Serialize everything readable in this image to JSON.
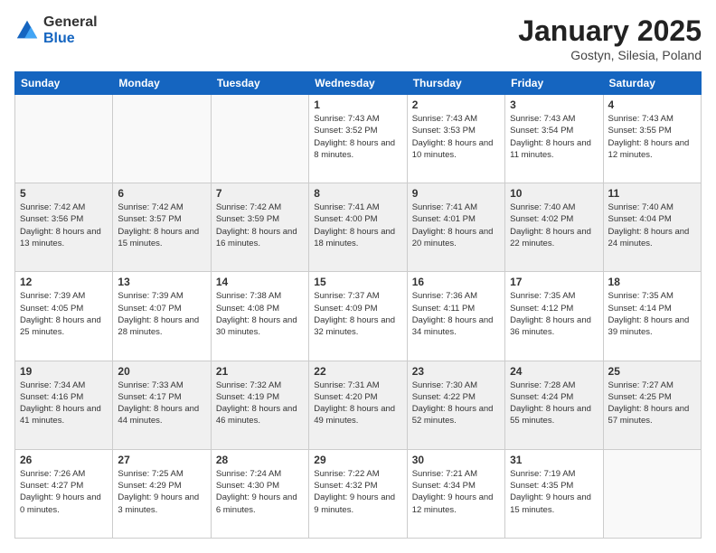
{
  "logo": {
    "general": "General",
    "blue": "Blue"
  },
  "header": {
    "month": "January 2025",
    "location": "Gostyn, Silesia, Poland"
  },
  "weekdays": [
    "Sunday",
    "Monday",
    "Tuesday",
    "Wednesday",
    "Thursday",
    "Friday",
    "Saturday"
  ],
  "weeks": [
    [
      {
        "day": "",
        "info": ""
      },
      {
        "day": "",
        "info": ""
      },
      {
        "day": "",
        "info": ""
      },
      {
        "day": "1",
        "info": "Sunrise: 7:43 AM\nSunset: 3:52 PM\nDaylight: 8 hours\nand 8 minutes."
      },
      {
        "day": "2",
        "info": "Sunrise: 7:43 AM\nSunset: 3:53 PM\nDaylight: 8 hours\nand 10 minutes."
      },
      {
        "day": "3",
        "info": "Sunrise: 7:43 AM\nSunset: 3:54 PM\nDaylight: 8 hours\nand 11 minutes."
      },
      {
        "day": "4",
        "info": "Sunrise: 7:43 AM\nSunset: 3:55 PM\nDaylight: 8 hours\nand 12 minutes."
      }
    ],
    [
      {
        "day": "5",
        "info": "Sunrise: 7:42 AM\nSunset: 3:56 PM\nDaylight: 8 hours\nand 13 minutes."
      },
      {
        "day": "6",
        "info": "Sunrise: 7:42 AM\nSunset: 3:57 PM\nDaylight: 8 hours\nand 15 minutes."
      },
      {
        "day": "7",
        "info": "Sunrise: 7:42 AM\nSunset: 3:59 PM\nDaylight: 8 hours\nand 16 minutes."
      },
      {
        "day": "8",
        "info": "Sunrise: 7:41 AM\nSunset: 4:00 PM\nDaylight: 8 hours\nand 18 minutes."
      },
      {
        "day": "9",
        "info": "Sunrise: 7:41 AM\nSunset: 4:01 PM\nDaylight: 8 hours\nand 20 minutes."
      },
      {
        "day": "10",
        "info": "Sunrise: 7:40 AM\nSunset: 4:02 PM\nDaylight: 8 hours\nand 22 minutes."
      },
      {
        "day": "11",
        "info": "Sunrise: 7:40 AM\nSunset: 4:04 PM\nDaylight: 8 hours\nand 24 minutes."
      }
    ],
    [
      {
        "day": "12",
        "info": "Sunrise: 7:39 AM\nSunset: 4:05 PM\nDaylight: 8 hours\nand 25 minutes."
      },
      {
        "day": "13",
        "info": "Sunrise: 7:39 AM\nSunset: 4:07 PM\nDaylight: 8 hours\nand 28 minutes."
      },
      {
        "day": "14",
        "info": "Sunrise: 7:38 AM\nSunset: 4:08 PM\nDaylight: 8 hours\nand 30 minutes."
      },
      {
        "day": "15",
        "info": "Sunrise: 7:37 AM\nSunset: 4:09 PM\nDaylight: 8 hours\nand 32 minutes."
      },
      {
        "day": "16",
        "info": "Sunrise: 7:36 AM\nSunset: 4:11 PM\nDaylight: 8 hours\nand 34 minutes."
      },
      {
        "day": "17",
        "info": "Sunrise: 7:35 AM\nSunset: 4:12 PM\nDaylight: 8 hours\nand 36 minutes."
      },
      {
        "day": "18",
        "info": "Sunrise: 7:35 AM\nSunset: 4:14 PM\nDaylight: 8 hours\nand 39 minutes."
      }
    ],
    [
      {
        "day": "19",
        "info": "Sunrise: 7:34 AM\nSunset: 4:16 PM\nDaylight: 8 hours\nand 41 minutes."
      },
      {
        "day": "20",
        "info": "Sunrise: 7:33 AM\nSunset: 4:17 PM\nDaylight: 8 hours\nand 44 minutes."
      },
      {
        "day": "21",
        "info": "Sunrise: 7:32 AM\nSunset: 4:19 PM\nDaylight: 8 hours\nand 46 minutes."
      },
      {
        "day": "22",
        "info": "Sunrise: 7:31 AM\nSunset: 4:20 PM\nDaylight: 8 hours\nand 49 minutes."
      },
      {
        "day": "23",
        "info": "Sunrise: 7:30 AM\nSunset: 4:22 PM\nDaylight: 8 hours\nand 52 minutes."
      },
      {
        "day": "24",
        "info": "Sunrise: 7:28 AM\nSunset: 4:24 PM\nDaylight: 8 hours\nand 55 minutes."
      },
      {
        "day": "25",
        "info": "Sunrise: 7:27 AM\nSunset: 4:25 PM\nDaylight: 8 hours\nand 57 minutes."
      }
    ],
    [
      {
        "day": "26",
        "info": "Sunrise: 7:26 AM\nSunset: 4:27 PM\nDaylight: 9 hours\nand 0 minutes."
      },
      {
        "day": "27",
        "info": "Sunrise: 7:25 AM\nSunset: 4:29 PM\nDaylight: 9 hours\nand 3 minutes."
      },
      {
        "day": "28",
        "info": "Sunrise: 7:24 AM\nSunset: 4:30 PM\nDaylight: 9 hours\nand 6 minutes."
      },
      {
        "day": "29",
        "info": "Sunrise: 7:22 AM\nSunset: 4:32 PM\nDaylight: 9 hours\nand 9 minutes."
      },
      {
        "day": "30",
        "info": "Sunrise: 7:21 AM\nSunset: 4:34 PM\nDaylight: 9 hours\nand 12 minutes."
      },
      {
        "day": "31",
        "info": "Sunrise: 7:19 AM\nSunset: 4:35 PM\nDaylight: 9 hours\nand 15 minutes."
      },
      {
        "day": "",
        "info": ""
      }
    ]
  ]
}
